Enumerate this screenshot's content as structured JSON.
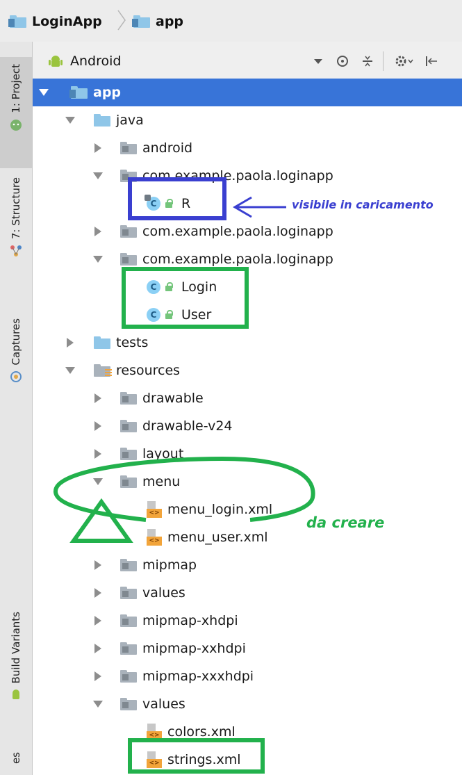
{
  "breadcrumb": {
    "items": [
      "LoginApp",
      "app"
    ]
  },
  "sidebar": {
    "tabs": [
      {
        "label": "1: Project",
        "icon": "android-icon"
      },
      {
        "label": "7: Structure",
        "icon": "structure-icon"
      },
      {
        "label": "Captures",
        "icon": "captures-icon"
      },
      {
        "label": "Build Variants",
        "icon": "android-icon"
      },
      {
        "label": "es"
      }
    ]
  },
  "toolbar": {
    "view_mode": "Android",
    "icons": [
      "target-icon",
      "collapse-icon",
      "gear-icon",
      "hide-icon"
    ]
  },
  "tree": [
    {
      "label": "app",
      "level": 0,
      "expanded": true,
      "icon": "module-folder-icon",
      "selected": true
    },
    {
      "label": "java",
      "level": 1,
      "expanded": true,
      "icon": "source-folder-icon"
    },
    {
      "label": "android",
      "level": 2,
      "expanded": false,
      "icon": "package-icon"
    },
    {
      "label": "com.example.paola.loginapp",
      "level": 2,
      "expanded": true,
      "icon": "package-icon"
    },
    {
      "label": "R",
      "level": 3,
      "icon": "class-icon"
    },
    {
      "label": "com.example.paola.loginapp",
      "level": 2,
      "expanded": false,
      "icon": "package-icon"
    },
    {
      "label": "com.example.paola.loginapp",
      "level": 2,
      "expanded": true,
      "icon": "package-icon"
    },
    {
      "label": "Login",
      "level": 3,
      "icon": "class-icon"
    },
    {
      "label": "User",
      "level": 3,
      "icon": "class-icon"
    },
    {
      "label": "tests",
      "level": 1,
      "expanded": false,
      "icon": "source-folder-icon"
    },
    {
      "label": "resources",
      "level": 1,
      "expanded": true,
      "icon": "resources-folder-icon"
    },
    {
      "label": "drawable",
      "level": 2,
      "expanded": false,
      "icon": "folder-icon"
    },
    {
      "label": "drawable-v24",
      "level": 2,
      "expanded": false,
      "icon": "folder-icon"
    },
    {
      "label": "layout",
      "level": 2,
      "expanded": false,
      "icon": "folder-icon"
    },
    {
      "label": "menu",
      "level": 2,
      "expanded": true,
      "icon": "folder-icon"
    },
    {
      "label": "menu_login.xml",
      "level": 3,
      "icon": "xml-file-icon"
    },
    {
      "label": "menu_user.xml",
      "level": 3,
      "icon": "xml-file-icon"
    },
    {
      "label": "mipmap",
      "level": 2,
      "expanded": false,
      "icon": "folder-icon"
    },
    {
      "label": "values",
      "level": 2,
      "expanded": false,
      "icon": "folder-icon"
    },
    {
      "label": "mipmap-xhdpi",
      "level": 2,
      "expanded": false,
      "icon": "folder-icon"
    },
    {
      "label": "mipmap-xxhdpi",
      "level": 2,
      "expanded": false,
      "icon": "folder-icon"
    },
    {
      "label": "mipmap-xxxhdpi",
      "level": 2,
      "expanded": false,
      "icon": "folder-icon"
    },
    {
      "label": "values",
      "level": 2,
      "expanded": true,
      "icon": "folder-icon"
    },
    {
      "label": "colors.xml",
      "level": 3,
      "icon": "xml-file-icon"
    },
    {
      "label": "strings.xml",
      "level": 3,
      "icon": "xml-file-icon"
    }
  ],
  "annotations": {
    "visible_note": "visibile in caricamento",
    "create_note": "da creare",
    "blue_color": "#3a3fd0",
    "green_color": "#22b14c"
  },
  "colors": {
    "selection": "#3874d8",
    "toolbar_bg": "#efefef",
    "sidebar_bg": "#e6e6e6"
  }
}
